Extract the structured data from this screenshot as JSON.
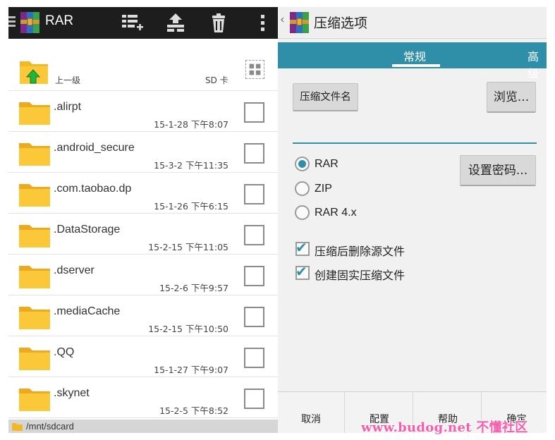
{
  "left_pane": {
    "app_title": "RAR",
    "toolbar_icons": [
      "list-add-icon",
      "extract-icon",
      "delete-icon",
      "overflow-menu-icon"
    ],
    "up_row": {
      "label": "上一级",
      "sd_label": "SD 卡"
    },
    "files": [
      {
        "name": ".alirpt",
        "date": "15-1-28 下午8:07"
      },
      {
        "name": ".android_secure",
        "date": "15-3-2 下午11:35"
      },
      {
        "name": ".com.taobao.dp",
        "date": "15-1-26 下午6:15"
      },
      {
        "name": ".DataStorage",
        "date": "15-2-15 下午11:05"
      },
      {
        "name": ".dserver",
        "date": "15-2-6 下午9:57"
      },
      {
        "name": ".mediaCache",
        "date": "15-2-15 下午10:50"
      },
      {
        "name": ".QQ",
        "date": "15-1-27 下午9:07"
      },
      {
        "name": ".skynet",
        "date": "15-2-5 下午8:52"
      }
    ],
    "path": "/mnt/sdcard"
  },
  "right_pane": {
    "title": "压缩选项",
    "tabs": [
      "常规",
      "高级"
    ],
    "archive_name_button": "压缩文件名",
    "browse_button": "浏览...",
    "archive_name_value": "",
    "set_password_button": "设置密码...",
    "formats": [
      {
        "label": "RAR",
        "selected": true
      },
      {
        "label": "ZIP",
        "selected": false
      },
      {
        "label": "RAR 4.x",
        "selected": false
      }
    ],
    "options": [
      {
        "label": "压缩后删除源文件",
        "checked": true
      },
      {
        "label": "创建固实压缩文件",
        "checked": true
      }
    ],
    "footer_buttons": [
      "取消",
      "配置",
      "帮助",
      "确定"
    ]
  },
  "colors": {
    "accent": "#2f8fa8",
    "toolbar_dark": "#1d1d1d",
    "folder": "#f5b825"
  },
  "watermark": "www.budog.net 不懂社区"
}
